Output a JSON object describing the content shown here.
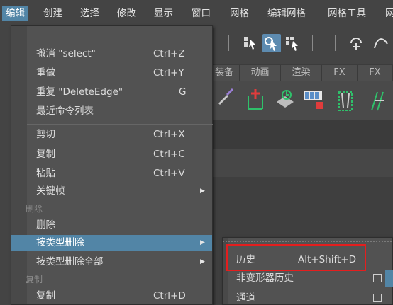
{
  "menubar": {
    "items": [
      {
        "label": "编辑",
        "active": true
      },
      {
        "label": "创建"
      },
      {
        "label": "选择"
      },
      {
        "label": "修改"
      },
      {
        "label": "显示"
      },
      {
        "label": "窗口"
      },
      {
        "label": "网格"
      },
      {
        "label": "编辑网格"
      },
      {
        "label": "网格工具"
      },
      {
        "label": "网"
      }
    ]
  },
  "shelf_tabs": [
    "装备",
    "动画",
    "渲染",
    "FX",
    "FX"
  ],
  "edit_menu": {
    "items": [
      {
        "label": "撤消 \"select\"",
        "shortcut": "Ctrl+Z"
      },
      {
        "label": "重做",
        "shortcut": "Ctrl+Y"
      },
      {
        "label": "重复 \"DeleteEdge\"",
        "shortcut": "G"
      },
      {
        "label": "最近命令列表",
        "shortcut": ""
      },
      {
        "label": "剪切",
        "shortcut": "Ctrl+X"
      },
      {
        "label": "复制",
        "shortcut": "Ctrl+C"
      },
      {
        "label": "粘贴",
        "shortcut": "Ctrl+V"
      },
      {
        "label": "关键帧",
        "shortcut": "",
        "submenu": true
      },
      {
        "label": "删除",
        "shortcut": ""
      },
      {
        "label": "按类型删除",
        "shortcut": "",
        "submenu": true,
        "highlighted": true
      },
      {
        "label": "按类型删除全部",
        "shortcut": "",
        "submenu": true
      },
      {
        "label": "复制",
        "shortcut": "Ctrl+D"
      }
    ],
    "sections": [
      "删除",
      "复制"
    ]
  },
  "delete_by_type_submenu": {
    "items": [
      {
        "label": "历史",
        "shortcut": "Alt+Shift+D",
        "highlighted_box": true
      },
      {
        "label": "非变形器历史",
        "option_box": true
      },
      {
        "label": "通道",
        "option_box": true
      }
    ]
  },
  "colors": {
    "menu_bg": "#525252",
    "highlight": "#5285a6",
    "annotation_frame": "#e41e1e"
  }
}
